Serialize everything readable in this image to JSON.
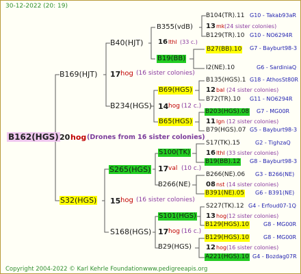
{
  "header": {
    "date": "30-12-2022 (20: 19)"
  },
  "root": {
    "id": "B162(HGS)",
    "age": "20",
    "hog": "hog",
    "drones": "(Drones from 16 sister colonies)"
  },
  "gen1": [
    {
      "id": "B169(HJT)"
    },
    {
      "id": "S32(HGS)"
    }
  ],
  "gen2": [
    {
      "id": "B40(HJT)",
      "age": "17",
      "hog": "hog",
      "sis": "(16 sister colonies)"
    },
    {
      "id": "B234(HGS)",
      "age": "14",
      "hog": "hog",
      "sis": "(12 c.)"
    },
    {
      "id": "S265(HGS)",
      "age": "17",
      "hog": "val",
      "sis": "(10 c.)"
    },
    {
      "id": "S168(HGS)",
      "age": "15",
      "hog": "hog",
      "sis": "(16 c.)"
    }
  ],
  "mid": [
    {
      "id": "B355(vdB)",
      "age": "13",
      "hog": "mk",
      "sis": "(24 sister colonies)"
    },
    {
      "id": "B19(BB)",
      "age": "16",
      "hog": "lthl",
      "sis": "(33 c.)"
    },
    {
      "id": "B69(HGS)",
      "age": "12",
      "hog": "bal",
      "sis": "(24 sister colonies)"
    },
    {
      "id": "B65(HGS)",
      "age": "11",
      "hog": "lgn",
      "sis": "(12 sister colonies)"
    },
    {
      "id": "S100(TK)",
      "age": "16",
      "hog": "lthl",
      "sis": "(33 sister colonies)"
    },
    {
      "id": "B266(NE)",
      "age": "08",
      "hog": "nst",
      "sis": "(14 sister colonies)"
    },
    {
      "id": "S101(HGS)",
      "age": "13",
      "hog": "hog",
      "sis": "(12 sister colonies)"
    },
    {
      "id": "B29(HGS)",
      "age": "12",
      "hog": "hog",
      "sis": "(16 sister colonies)"
    }
  ],
  "right": [
    {
      "id": "B104(TR).11",
      "code": "G10 - Takab93aR"
    },
    {
      "id": "B129(TR).10",
      "code": "G10 - NO6294R"
    },
    {
      "id": "B27(BB).10",
      "code": "G7 - Bayburt98-3"
    },
    {
      "id": "I2(NE).10",
      "code": "G6 - SardiniaQ"
    },
    {
      "id": "B135(HGS).1",
      "code": "G18 - AthosSt80R"
    },
    {
      "id": "B72(TR).10",
      "code": "G11 - NO6294R"
    },
    {
      "id": "B203(HGS).08",
      "code": "G7 - MG00R"
    },
    {
      "id": "B79(HGS).07",
      "code": "G5 - Bayburt98-3"
    },
    {
      "id": "S17(TK).15",
      "code": "G2 - TighzaQ"
    },
    {
      "id": "B19(BB).12",
      "code": "G8 - Bayburt98-3"
    },
    {
      "id": "B266(NE).06",
      "code": "G3 - B266(NE)"
    },
    {
      "id": "B391(NE).05",
      "code": "G6 - B391(NE)"
    },
    {
      "id": "S227(TK).12",
      "code": "G4 - Erfoud07-1Q"
    },
    {
      "id": "B129(HGS).10",
      "code": "G8 - MG00R"
    },
    {
      "id": "B129(HGS).10",
      "code": "G8 - MG00R"
    },
    {
      "id": "A221(HGS).10",
      "code": "G4 - Bozdag07R"
    }
  ],
  "footer": {
    "copyright": "Copyright 2004-2022 © Karl Kehrle Foundation",
    "url": "www.pedigreeapis.org"
  },
  "colors": {
    "yellow": "#ffff00",
    "green": "#22cc22",
    "lavender": "#f0c8f0",
    "line": "#5a5a5a",
    "frame": "#b89a3a"
  }
}
